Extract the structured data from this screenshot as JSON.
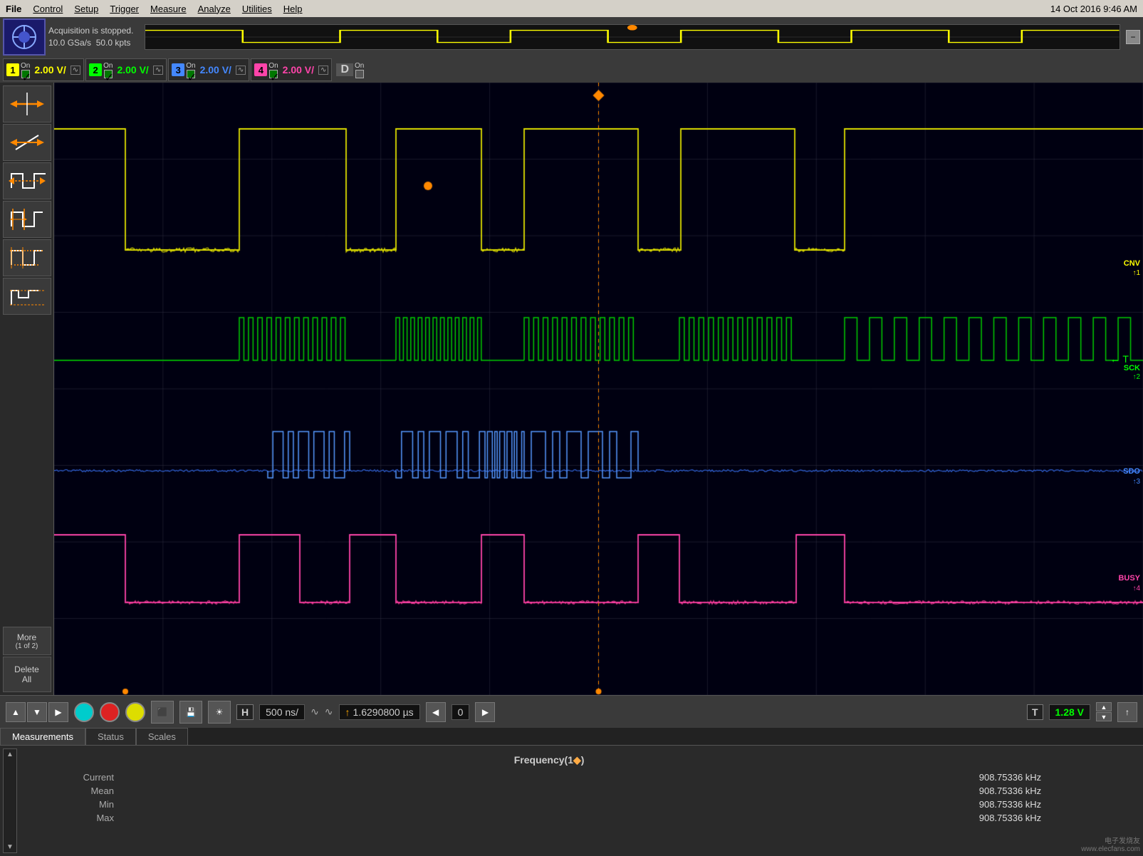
{
  "menubar": {
    "items": [
      "File",
      "Control",
      "Setup",
      "Trigger",
      "Measure",
      "Analyze",
      "Utilities",
      "Help"
    ],
    "datetime": "14 Oct 2016  9:46 AM"
  },
  "acq": {
    "status": "Acquisition is stopped.",
    "rate": "10.0 GSa/s",
    "points": "50.0 kpts"
  },
  "channels": [
    {
      "num": "1",
      "color": "ch1",
      "volt_color": "y",
      "volt": "2.00 V/",
      "on": "On"
    },
    {
      "num": "2",
      "color": "ch2",
      "volt_color": "g",
      "volt": "2.00 V/",
      "on": "On"
    },
    {
      "num": "3",
      "color": "ch3",
      "volt_color": "b",
      "volt": "2.00 V/",
      "on": "On"
    },
    {
      "num": "4",
      "color": "ch4",
      "volt_color": "p",
      "volt": "2.00 V/",
      "on": "On"
    }
  ],
  "digital": {
    "label": "D",
    "on": "On"
  },
  "tools": [
    {
      "name": "cursor-tool",
      "label": "↔"
    },
    {
      "name": "diagonal-tool",
      "label": "↗"
    },
    {
      "name": "pulse-tool",
      "label": "⊓"
    },
    {
      "name": "edge-tool",
      "label": "⊓↔"
    },
    {
      "name": "step-tool",
      "label": "⊓⌇"
    },
    {
      "name": "runt-tool",
      "label": "⊓⌇2"
    }
  ],
  "bottom_toolbar": {
    "h_label": "H",
    "h_value": "500 ns/",
    "trigger_time": "1.6290800 µs",
    "trigger_icon": "↑",
    "t_label": "T",
    "t_value": "1.28 V",
    "zero_value": "0",
    "up_arrow": "▲",
    "down_arrow": "▼"
  },
  "tabs": [
    {
      "name": "Measurements",
      "active": true
    },
    {
      "name": "Status",
      "active": false
    },
    {
      "name": "Scales",
      "active": false
    }
  ],
  "measurements": {
    "title": "Frequency(1",
    "ch_ref": "◆",
    "closing": ")",
    "rows": [
      {
        "key": "Current",
        "value": "908.75336 kHz"
      },
      {
        "key": "Mean",
        "value": "908.75336 kHz"
      },
      {
        "key": "Min",
        "value": "908.75336 kHz"
      },
      {
        "key": "Max",
        "value": "908.75336 kHz"
      }
    ]
  },
  "signals": {
    "cnv": "CNV",
    "sck": "SCK",
    "sdo": "SDO",
    "busy": "BUSY"
  },
  "watermark": "电子发烧友\nwww.elecfans.com"
}
